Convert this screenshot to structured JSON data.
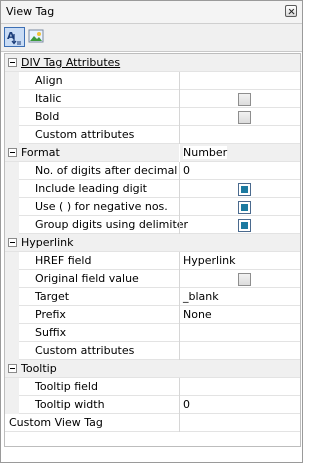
{
  "window": {
    "title": "View Tag"
  },
  "toolbar": {
    "buttons": [
      {
        "icon": "sort-alphabetical-icon",
        "label": "A"
      },
      {
        "icon": "image-icon"
      }
    ]
  },
  "categories": {
    "div": {
      "label": "DIV Tag Attributes"
    },
    "format": {
      "label": "Format"
    },
    "hyperlink": {
      "label": "Hyperlink"
    },
    "tooltip": {
      "label": "Tooltip"
    }
  },
  "props": {
    "align": {
      "name": "Align",
      "value": ""
    },
    "italic": {
      "name": "Italic",
      "checked": false
    },
    "bold": {
      "name": "Bold",
      "checked": false
    },
    "custom_attrs_div": {
      "name": "Custom attributes",
      "value": ""
    },
    "format_value": "Number",
    "digits": {
      "name": "No. of digits after decimal",
      "value": "0"
    },
    "leading_digit": {
      "name": "Include leading digit",
      "checked": true
    },
    "negative": {
      "name": "Use ( ) for negative nos.",
      "checked": true
    },
    "group_digits": {
      "name": "Group digits using delimiter",
      "checked": true
    },
    "href": {
      "name": "HREF field",
      "value": "Hyperlink"
    },
    "original_value": {
      "name": "Original field value",
      "checked": false
    },
    "target": {
      "name": "Target",
      "value": "_blank"
    },
    "prefix": {
      "name": "Prefix",
      "value": "None"
    },
    "suffix": {
      "name": "Suffix",
      "value": ""
    },
    "custom_attrs_link": {
      "name": "Custom attributes",
      "value": ""
    },
    "tooltip_field": {
      "name": "Tooltip field",
      "value": ""
    },
    "tooltip_width": {
      "name": "Tooltip width",
      "value": "0"
    },
    "custom_view_tag": {
      "name": "Custom View Tag",
      "value": ""
    }
  }
}
